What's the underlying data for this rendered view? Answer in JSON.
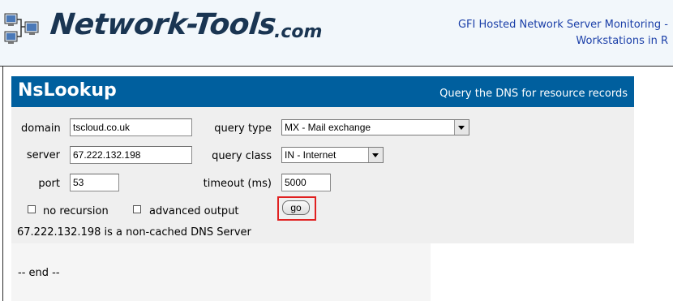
{
  "header": {
    "logo_main": "Network-Tools",
    "logo_domain": ".com",
    "ad_line1": "GFI Hosted Network Server Monitoring -",
    "ad_line2": "Workstations in R"
  },
  "tool": {
    "title": "NsLookup",
    "subtitle": "Query the DNS for resource records"
  },
  "form": {
    "domain_label": "domain",
    "domain_value": "tscloud.co.uk",
    "server_label": "server",
    "server_value": "67.222.132.198",
    "port_label": "port",
    "port_value": "53",
    "query_type_label": "query type",
    "query_type_value": "MX - Mail exchange",
    "query_class_label": "query class",
    "query_class_value": "IN - Internet",
    "timeout_label": "timeout (ms)",
    "timeout_value": "5000",
    "no_recursion_label": "no recursion",
    "advanced_output_label": "advanced output",
    "go_label": "go"
  },
  "result": {
    "message": "67.222.132.198 is a non-cached DNS Server",
    "end_text": "-- end --"
  },
  "colors": {
    "title_bar": "#005f9e",
    "highlight": "#e02020",
    "logo": "#1a3552",
    "ad_link": "#1b3fa8"
  }
}
